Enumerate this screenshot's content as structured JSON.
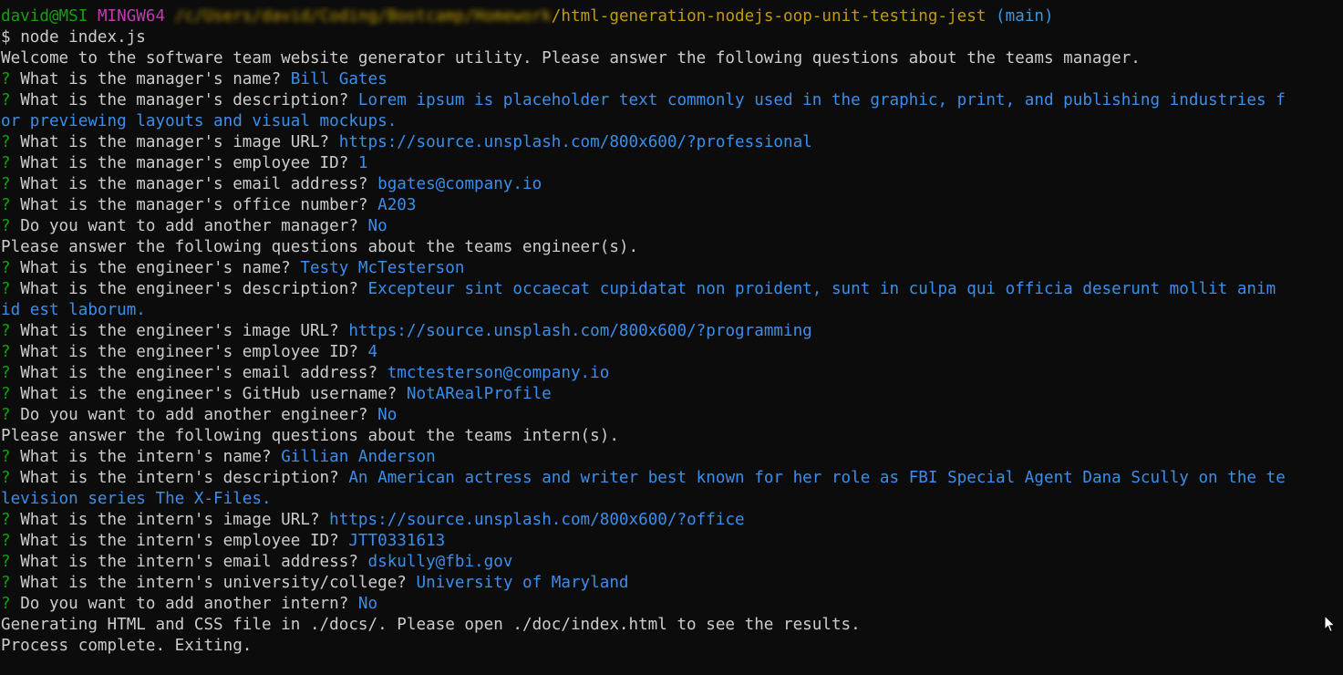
{
  "prompt": {
    "user_host": "david@MSI",
    "env": "MINGW64",
    "blurred_path": "/c/Users/david/Coding/Bootcamp/Homework",
    "path": "/html-generation-nodejs-oop-unit-testing-jest",
    "branch": "(main)",
    "symbol": "$",
    "command": "node index.js"
  },
  "colors": {
    "background": "#0c0c0c",
    "text": "#cccccc",
    "green": "#13a10e",
    "magenta": "#c239b3",
    "yellow": "#c19c00",
    "cyan": "#3a96dd",
    "answer": "#3b8eea"
  },
  "lines": [
    {
      "type": "plain",
      "text": "Welcome to the software team website generator utility. Please answer the following questions about the teams manager."
    },
    {
      "type": "qa",
      "question": "What is the manager's name?",
      "answer": "Bill Gates"
    },
    {
      "type": "qa",
      "question": "What is the manager's description?",
      "answer": "Lorem ipsum is placeholder text commonly used in the graphic, print, and publishing industries f"
    },
    {
      "type": "cont",
      "text": "or previewing layouts and visual mockups."
    },
    {
      "type": "qa",
      "question": "What is the manager's image URL?",
      "answer": "https://source.unsplash.com/800x600/?professional"
    },
    {
      "type": "qa",
      "question": "What is the manager's employee ID?",
      "answer": "1"
    },
    {
      "type": "qa",
      "question": "What is the manager's email address?",
      "answer": "bgates@company.io"
    },
    {
      "type": "qa",
      "question": "What is the manager's office number?",
      "answer": "A203"
    },
    {
      "type": "qa",
      "question": "Do you want to add another manager?",
      "answer": "No"
    },
    {
      "type": "plain",
      "text": "Please answer the following questions about the teams engineer(s)."
    },
    {
      "type": "qa",
      "question": "What is the engineer's name?",
      "answer": "Testy McTesterson"
    },
    {
      "type": "qa",
      "question": "What is the engineer's description?",
      "answer": "Excepteur sint occaecat cupidatat non proident, sunt in culpa qui officia deserunt mollit anim"
    },
    {
      "type": "cont",
      "text": "id est laborum."
    },
    {
      "type": "qa",
      "question": "What is the engineer's image URL?",
      "answer": "https://source.unsplash.com/800x600/?programming"
    },
    {
      "type": "qa",
      "question": "What is the engineer's employee ID?",
      "answer": "4"
    },
    {
      "type": "qa",
      "question": "What is the engineer's email address?",
      "answer": "tmctesterson@company.io"
    },
    {
      "type": "qa",
      "question": "What is the engineer's GitHub username?",
      "answer": "NotARealProfile"
    },
    {
      "type": "qa",
      "question": "Do you want to add another engineer?",
      "answer": "No"
    },
    {
      "type": "plain",
      "text": "Please answer the following questions about the teams intern(s)."
    },
    {
      "type": "qa",
      "question": "What is the intern's name?",
      "answer": "Gillian Anderson"
    },
    {
      "type": "qa",
      "question": "What is the intern's description?",
      "answer": "An American actress and writer best known for her role as FBI Special Agent Dana Scully on the te"
    },
    {
      "type": "cont",
      "text": "levision series The X-Files."
    },
    {
      "type": "qa",
      "question": "What is the intern's image URL?",
      "answer": "https://source.unsplash.com/800x600/?office"
    },
    {
      "type": "qa",
      "question": "What is the intern's employee ID?",
      "answer": "JTT0331613"
    },
    {
      "type": "qa",
      "question": "What is the intern's email address?",
      "answer": "dskully@fbi.gov"
    },
    {
      "type": "qa",
      "question": "What is the intern's university/college?",
      "answer": "University of Maryland"
    },
    {
      "type": "qa",
      "question": "Do you want to add another intern?",
      "answer": "No"
    },
    {
      "type": "plain",
      "text": "Generating HTML and CSS file in ./docs/. Please open ./doc/index.html to see the results."
    },
    {
      "type": "plain",
      "text": "Process complete. Exiting."
    }
  ],
  "qmark": "?",
  "cursor_icon": "mouse-pointer-icon"
}
